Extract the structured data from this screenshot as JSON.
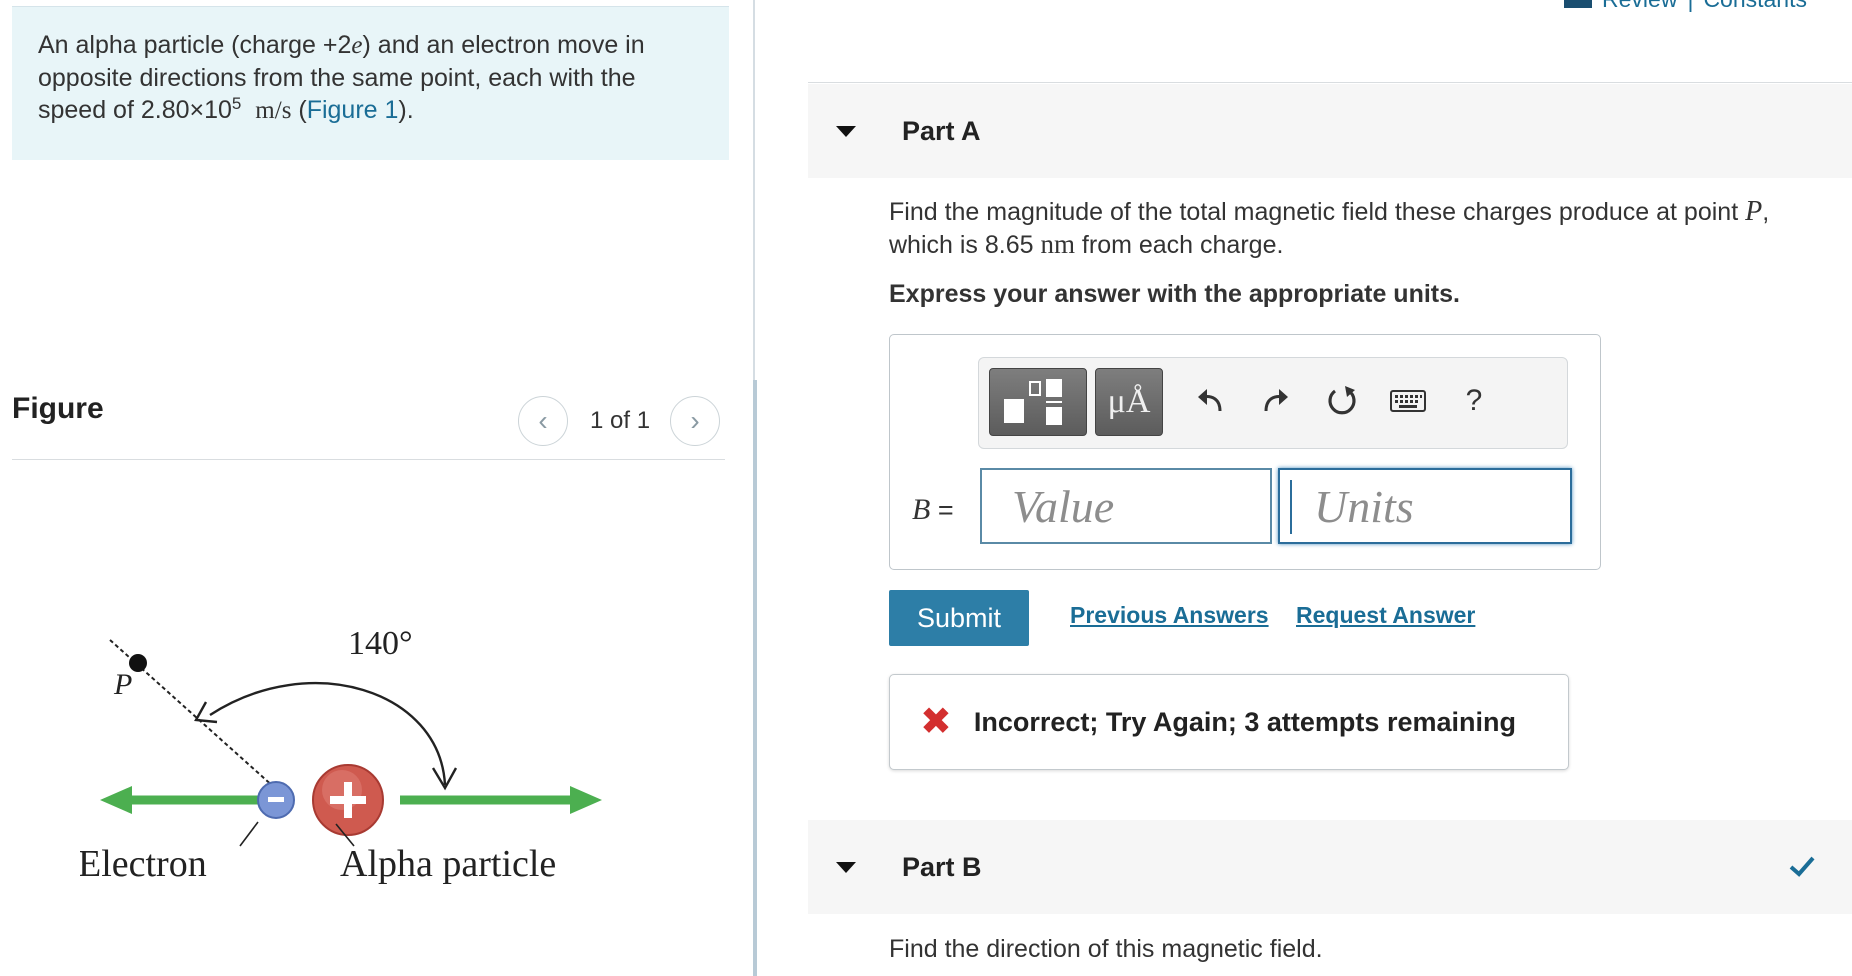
{
  "problem": {
    "text_1": "An alpha particle (charge +2",
    "charge_var": "e",
    "text_2": ") and an electron move in opposite directions from the same point, each with the speed of 2.80×10",
    "exponent": "5",
    "speed_unit": "m/s",
    "open_paren": " (",
    "figure_link": "Figure 1",
    "close_paren": ")."
  },
  "figure": {
    "heading": "Figure",
    "counter": "1 of 1",
    "prev_glyph": "‹",
    "next_glyph": "›",
    "angle_label": "140°",
    "point_label": "P",
    "electron_label": "Electron",
    "alpha_label": "Alpha particle",
    "colors": {
      "arrow_green": "#4caf50",
      "electron_blue": "#6f8fd1",
      "alpha_red": "#c9504a"
    }
  },
  "header": {
    "review_label": "Review",
    "separator": "|",
    "constants_label": "Constants"
  },
  "part_a": {
    "title": "Part A",
    "question_1": "Find the magnitude of the total magnetic field these charges produce at point ",
    "point_var": "P",
    "question_2": ", which is 8.65 ",
    "distance_unit": "nm",
    "question_3": " from each charge.",
    "instruction": "Express your answer with the appropriate units.",
    "toolbar": {
      "units_button": "μÅ",
      "help_button": "?"
    },
    "answer_var": "B",
    "equals": " =",
    "value_placeholder": "Value",
    "units_placeholder": "Units",
    "submit_label": "Submit",
    "previous_answers_label": "Previous Answers",
    "request_answer_label": "Request Answer",
    "feedback_icon": "✖",
    "feedback_message": "Incorrect; Try Again; 3 attempts remaining"
  },
  "part_b": {
    "title": "Part B",
    "question": "Find the direction of this magnetic field."
  },
  "colors": {
    "accent": "#2d7ea7",
    "link": "#1a6d96",
    "error": "#d32f2f",
    "problem_bg": "#e8f5f8"
  }
}
